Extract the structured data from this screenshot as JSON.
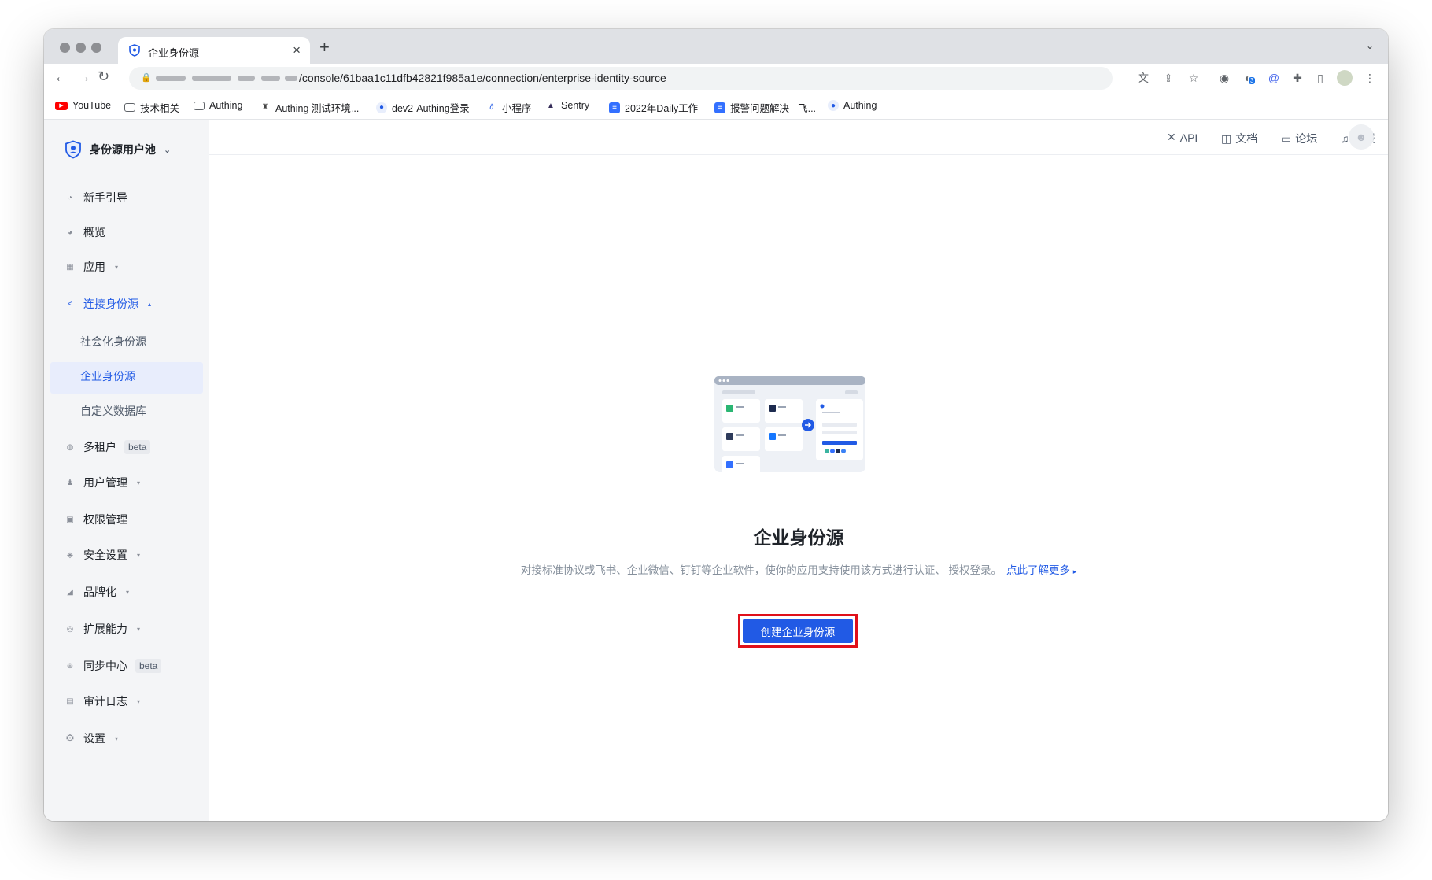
{
  "browser": {
    "tab_title": "企业身份源",
    "tab_close": "×",
    "new_tab": "+",
    "tab_menu": "⌄",
    "url": "/console/61baa1c11dfb42821f985a1e/connection/enterprise-identity-source",
    "extension_badge": "3",
    "bookmarks": [
      {
        "label": "YouTube",
        "icon": "youtube-icon",
        "color": "#ff0000"
      },
      {
        "label": "技术相关",
        "icon": "folder-icon"
      },
      {
        "label": "Authing",
        "icon": "folder-icon"
      },
      {
        "label": "Authing 测试环境...",
        "icon": "authing-logo-icon"
      },
      {
        "label": "dev2-Authing登录",
        "icon": "authing-favicon-icon"
      },
      {
        "label": "小程序",
        "icon": "link-icon"
      },
      {
        "label": "Sentry",
        "icon": "sentry-icon"
      },
      {
        "label": "2022年Daily工作",
        "icon": "doc-icon"
      },
      {
        "label": "报警问题解决 - 飞...",
        "icon": "doc-icon"
      },
      {
        "label": "Authing",
        "icon": "authing-favicon-icon"
      }
    ]
  },
  "sidebar": {
    "pool_name": "身份源用户池",
    "items": [
      {
        "label": "新手引导",
        "icon": "guide-icon"
      },
      {
        "label": "概览",
        "icon": "pie-chart-icon"
      },
      {
        "label": "应用",
        "icon": "apps-icon"
      },
      {
        "label": "连接身份源",
        "icon": "connection-icon"
      },
      {
        "label": "多租户",
        "icon": "tenant-icon"
      },
      {
        "label": "用户管理",
        "icon": "users-icon"
      },
      {
        "label": "权限管理",
        "icon": "lock-icon"
      },
      {
        "label": "安全设置",
        "icon": "shield-icon"
      },
      {
        "label": "品牌化",
        "icon": "brush-icon"
      },
      {
        "label": "扩展能力",
        "icon": "extension-icon"
      },
      {
        "label": "同步中心",
        "icon": "sync-icon"
      },
      {
        "label": "审计日志",
        "icon": "audit-icon"
      },
      {
        "label": "设置",
        "icon": "settings-icon"
      }
    ],
    "sub_items": [
      "社会化身份源",
      "企业身份源",
      "自定义数据库"
    ],
    "beta": "beta",
    "active_color": "#215ae5"
  },
  "topbar": {
    "links": [
      {
        "label": "API",
        "icon": "api-icon"
      },
      {
        "label": "文档",
        "icon": "book-icon"
      },
      {
        "label": "论坛",
        "icon": "forum-icon"
      },
      {
        "label": "客服",
        "icon": "headset-icon"
      }
    ]
  },
  "empty_state": {
    "title": "企业身份源",
    "description": "对接标准协议或飞书、企业微信、钉钉等企业软件，使你的应用支持使用该方式进行认证、 授权登录。",
    "learn_more": "点此了解更多",
    "button": "创建企业身份源"
  }
}
